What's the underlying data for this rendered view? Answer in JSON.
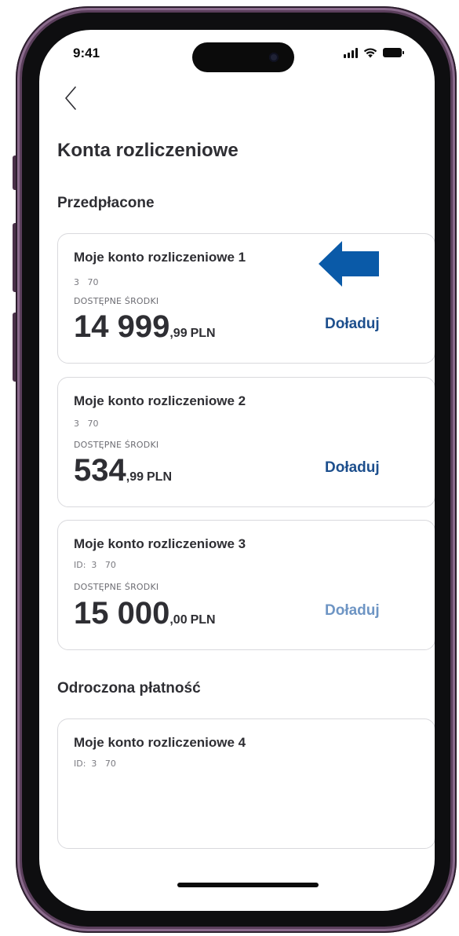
{
  "status_bar": {
    "time": "9:41"
  },
  "header": {
    "title": "Konta rozliczeniowe"
  },
  "sections": {
    "prepaid": {
      "title": "Przedpłacone"
    },
    "deferred": {
      "title": "Odroczona płatność"
    }
  },
  "accounts": [
    {
      "name": "Moje konto rozliczeniowe 1",
      "id": "3   70",
      "available_label": "DOSTĘPNE ŚRODKI",
      "amount_int": "14 999",
      "amount_dec": ",99",
      "currency": "PLN",
      "topup_label": "Doładuj"
    },
    {
      "name": "Moje konto rozliczeniowe 2",
      "id": "3   70",
      "available_label": "DOSTĘPNE ŚRODKI",
      "amount_int": "534",
      "amount_dec": ",99",
      "currency": "PLN",
      "topup_label": "Doładuj"
    },
    {
      "name": "Moje konto rozliczeniowe 3",
      "id": "ID:  3   70",
      "available_label": "DOSTĘPNE ŚRODKI",
      "amount_int": "15 000",
      "amount_dec": ",00",
      "currency": "PLN",
      "topup_label": "Doładuj"
    },
    {
      "name": "Moje konto rozliczeniowe 4",
      "id": "ID:  3   70"
    }
  ],
  "colors": {
    "accent": "#1d4f8d",
    "arrow": "#0a5aa8",
    "frame": "#5b3f5c"
  },
  "icons": [
    "back-chevron-icon",
    "signal-icon",
    "wifi-icon",
    "battery-icon",
    "arrow-left-icon"
  ]
}
